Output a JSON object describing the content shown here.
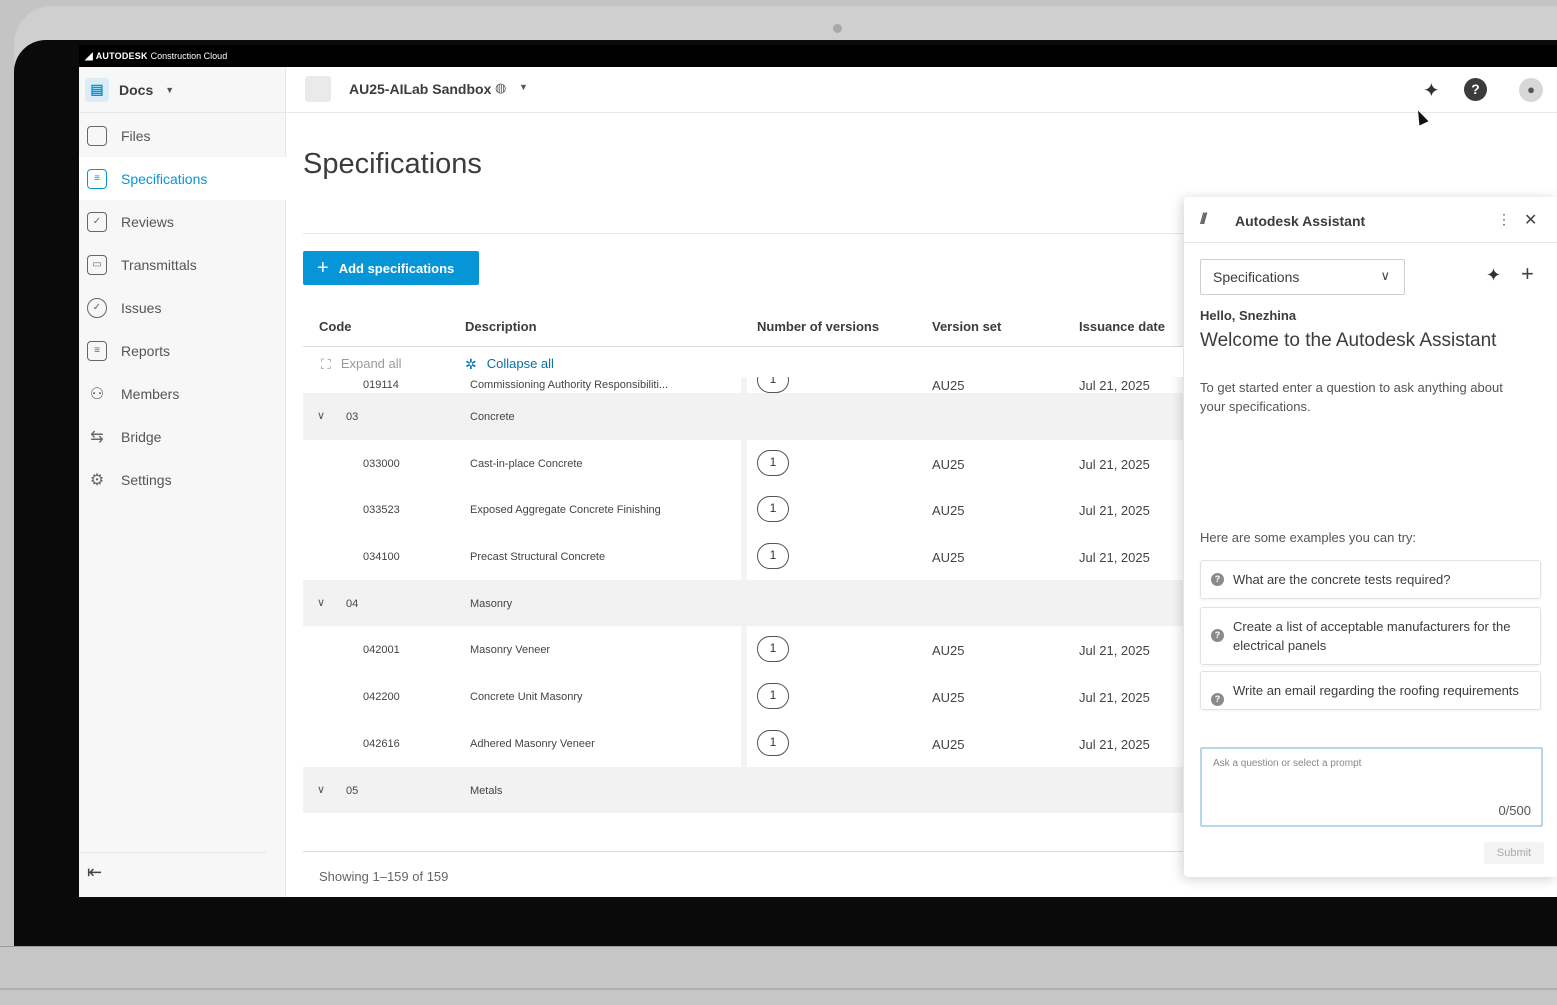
{
  "brand": {
    "mark": "◢",
    "name": "AUTODESK",
    "product": "Construction Cloud"
  },
  "sidebar": {
    "switcher_label": "Docs",
    "items": [
      {
        "label": "Files",
        "icon": "file-icon"
      },
      {
        "label": "Specifications",
        "icon": "specifications-icon",
        "active": true
      },
      {
        "label": "Reviews",
        "icon": "reviews-icon"
      },
      {
        "label": "Transmittals",
        "icon": "transmittals-icon"
      },
      {
        "label": "Issues",
        "icon": "issues-icon"
      },
      {
        "label": "Reports",
        "icon": "reports-icon"
      },
      {
        "label": "Members",
        "icon": "members-icon"
      },
      {
        "label": "Bridge",
        "icon": "bridge-icon"
      },
      {
        "label": "Settings",
        "icon": "settings-icon"
      }
    ]
  },
  "topbar": {
    "project_name": "AU25-AILab Sandbox"
  },
  "main": {
    "title": "Specifications",
    "add_button": "Add specifications",
    "columns": {
      "code": "Code",
      "description": "Description",
      "versions": "Number of versions",
      "version_set": "Version set",
      "issuance_date": "Issuance date"
    },
    "expand_all": "Expand all",
    "collapse_all": "Collapse all",
    "rows": [
      {
        "type": "item",
        "code": "019114",
        "description": "Commissioning Authority Responsibiliti...",
        "versions": "1",
        "version_set": "AU25",
        "date": "Jul 21, 2025"
      },
      {
        "type": "group",
        "code": "03",
        "description": "Concrete"
      },
      {
        "type": "item",
        "code": "033000",
        "description": "Cast-in-place Concrete",
        "versions": "1",
        "version_set": "AU25",
        "date": "Jul 21, 2025"
      },
      {
        "type": "item",
        "code": "033523",
        "description": "Exposed Aggregate Concrete Finishing",
        "versions": "1",
        "version_set": "AU25",
        "date": "Jul 21, 2025"
      },
      {
        "type": "item",
        "code": "034100",
        "description": "Precast Structural Concrete",
        "versions": "1",
        "version_set": "AU25",
        "date": "Jul 21, 2025"
      },
      {
        "type": "group",
        "code": "04",
        "description": "Masonry"
      },
      {
        "type": "item",
        "code": "042001",
        "description": "Masonry Veneer",
        "versions": "1",
        "version_set": "AU25",
        "date": "Jul 21, 2025"
      },
      {
        "type": "item",
        "code": "042200",
        "description": "Concrete Unit Masonry",
        "versions": "1",
        "version_set": "AU25",
        "date": "Jul 21, 2025"
      },
      {
        "type": "item",
        "code": "042616",
        "description": "Adhered Masonry Veneer",
        "versions": "1",
        "version_set": "AU25",
        "date": "Jul 21, 2025"
      },
      {
        "type": "group",
        "code": "05",
        "description": "Metals"
      }
    ],
    "showing": "Showing 1–159 of 159"
  },
  "assistant": {
    "title": "Autodesk Assistant",
    "scope": "Specifications",
    "hello": "Hello, Snezhina",
    "welcome": "Welcome to the Autodesk Assistant",
    "intro": "To get started enter a question to ask anything about your specifications.",
    "examples_label": "Here are some examples you can try:",
    "prompts": [
      "What are the concrete tests required?",
      "Create a list of acceptable manufacturers for the electrical panels",
      "Write an email regarding the roofing requirements"
    ],
    "input_placeholder": "Ask a question or select a prompt",
    "counter": "0/500",
    "submit": "Submit"
  },
  "colors": {
    "accent": "#0696d7",
    "link": "#0670a8",
    "group_row": "#f2f2f2"
  }
}
